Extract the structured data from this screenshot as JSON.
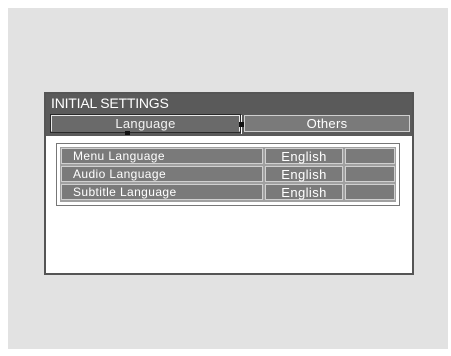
{
  "window": {
    "title": "INITIAL SETTINGS"
  },
  "tabs": [
    {
      "label": "Language",
      "selected": true
    },
    {
      "label": "Others",
      "selected": false
    }
  ],
  "settings": [
    {
      "label": "Menu Language",
      "value": "English"
    },
    {
      "label": "Audio Language",
      "value": "English"
    },
    {
      "label": "Subtitle Language",
      "value": "English"
    }
  ],
  "colors": {
    "title_bar": "#5a5a5a",
    "row_fill": "#7a7a7a",
    "page_background": "#e2e2e2"
  }
}
